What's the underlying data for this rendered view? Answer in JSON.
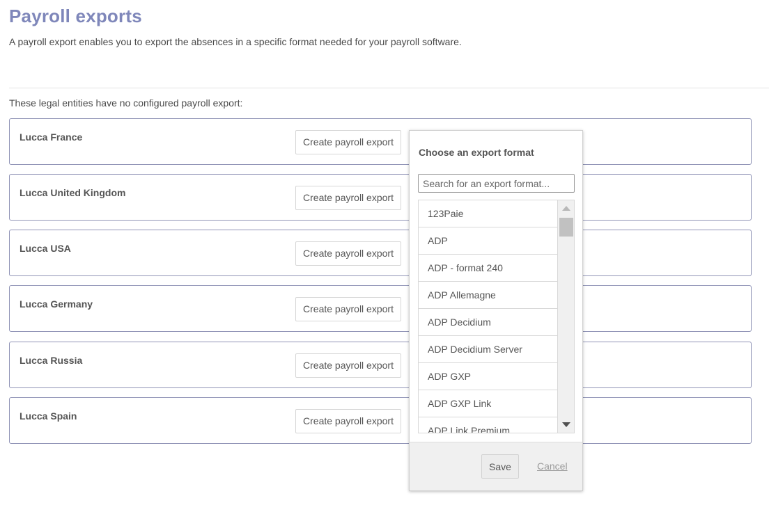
{
  "page": {
    "title": "Payroll exports",
    "description": "A payroll export enables you to export the absences in a specific format needed for your payroll software."
  },
  "section": {
    "label": "These legal entities have no configured payroll export:"
  },
  "entities": [
    {
      "name": "Lucca France",
      "button_label": "Create payroll export"
    },
    {
      "name": "Lucca United Kingdom",
      "button_label": "Create payroll export"
    },
    {
      "name": "Lucca USA",
      "button_label": "Create payroll export"
    },
    {
      "name": "Lucca Germany",
      "button_label": "Create payroll export"
    },
    {
      "name": "Lucca Russia",
      "button_label": "Create payroll export"
    },
    {
      "name": "Lucca Spain",
      "button_label": "Create payroll export"
    }
  ],
  "popover": {
    "title": "Choose an export format",
    "search_placeholder": "Search for an export format...",
    "search_value": "",
    "formats": [
      "123Paie",
      "ADP",
      "ADP - format 240",
      "ADP Allemagne",
      "ADP Decidium",
      "ADP Decidium Server",
      "ADP GXP",
      "ADP GXP Link",
      "ADP Link Premium"
    ],
    "save_label": "Save",
    "cancel_label": "Cancel"
  },
  "colors": {
    "title": "#7f87ba",
    "card_border": "#8f93b6"
  }
}
